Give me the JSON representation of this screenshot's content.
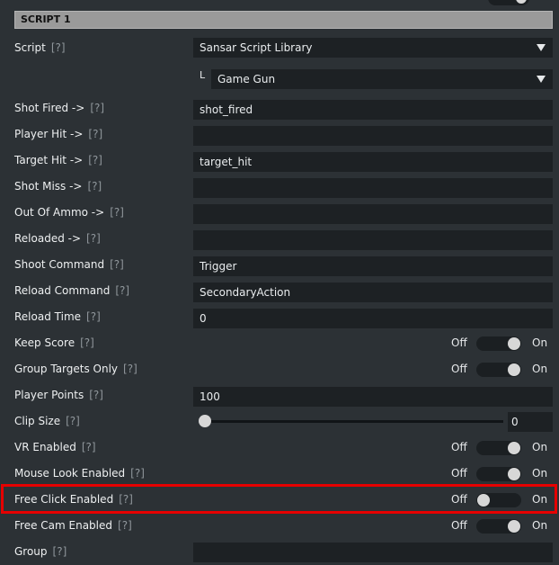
{
  "section": {
    "title": "SCRIPT 1"
  },
  "help_marker": "[?]",
  "script": {
    "label": "Script",
    "value": "Sansar Script Library",
    "sub_prefix": "L",
    "sub_value": "Game Gun"
  },
  "fields": {
    "shot_fired": {
      "label": "Shot Fired ->",
      "value": "shot_fired"
    },
    "player_hit": {
      "label": "Player Hit ->",
      "value": ""
    },
    "target_hit": {
      "label": "Target Hit ->",
      "value": "target_hit"
    },
    "shot_miss": {
      "label": "Shot Miss ->",
      "value": ""
    },
    "out_of_ammo": {
      "label": "Out Of Ammo ->",
      "value": ""
    },
    "reloaded": {
      "label": "Reloaded ->",
      "value": ""
    },
    "shoot_command": {
      "label": "Shoot Command",
      "value": "Trigger"
    },
    "reload_command": {
      "label": "Reload Command",
      "value": "SecondaryAction"
    },
    "reload_time": {
      "label": "Reload Time",
      "value": "0"
    },
    "player_points": {
      "label": "Player Points",
      "value": "100"
    },
    "group": {
      "label": "Group",
      "value": ""
    }
  },
  "toggles": {
    "off_label": "Off",
    "on_label": "On",
    "keep_score": {
      "label": "Keep Score",
      "state": "on"
    },
    "group_targets_only": {
      "label": "Group Targets Only",
      "state": "on"
    },
    "vr_enabled": {
      "label": "VR Enabled",
      "state": "on"
    },
    "mouse_look_enabled": {
      "label": "Mouse Look Enabled",
      "state": "on"
    },
    "free_click_enabled": {
      "label": "Free Click Enabled",
      "state": "off"
    },
    "free_cam_enabled": {
      "label": "Free Cam Enabled",
      "state": "on"
    }
  },
  "clip_size": {
    "label": "Clip Size",
    "value": "0"
  },
  "colors": {
    "highlight": "#e60000",
    "field_bg": "#1d2124",
    "panel_bg": "#2c3135"
  }
}
